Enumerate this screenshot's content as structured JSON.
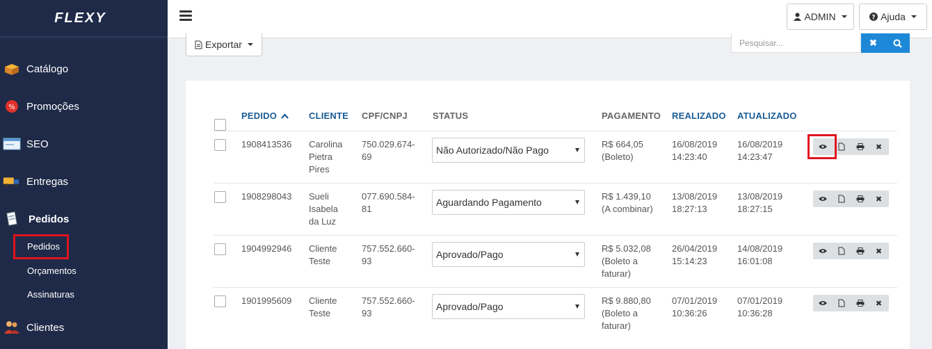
{
  "brand": {
    "logo": "FLEXY"
  },
  "sidebar": {
    "items": [
      {
        "label": "Catálogo",
        "icon": "box-icon"
      },
      {
        "label": "Promoções",
        "icon": "percent-icon"
      },
      {
        "label": "SEO",
        "icon": "window-icon"
      },
      {
        "label": "Entregas",
        "icon": "truck-icon"
      },
      {
        "label": "Pedidos",
        "icon": "document-icon"
      },
      {
        "label": "Clientes",
        "icon": "users-icon"
      }
    ],
    "subitems": [
      {
        "label": "Pedidos",
        "active": true
      },
      {
        "label": "Orçamentos"
      },
      {
        "label": "Assinaturas"
      }
    ]
  },
  "topbar": {
    "user_label": "ADMIN",
    "help_label": "Ajuda"
  },
  "toolbar": {
    "export_label": "Exportar",
    "search_placeholder": "Pesquisar..."
  },
  "table": {
    "headers": {
      "pedido": "PEDIDO",
      "cliente": "CLIENTE",
      "cpf": "CPF/CNPJ",
      "status": "STATUS",
      "pagamento": "PAGAMENTO",
      "realizado": "REALIZADO",
      "atualizado": "ATUALIZADO"
    },
    "rows": [
      {
        "pedido": "1908413536",
        "cliente": [
          "Carolina",
          "Pietra",
          "Pires"
        ],
        "cpf": [
          "750.029.674-",
          "69"
        ],
        "status": "Não Autorizado/Não Pago",
        "pagamento": [
          "R$ 664,05",
          "(Boleto)"
        ],
        "realizado": [
          "16/08/2019",
          "14:23:40"
        ],
        "atualizado": [
          "16/08/2019",
          "14:23:47"
        ]
      },
      {
        "pedido": "1908298043",
        "cliente": [
          "Sueli",
          "Isabela",
          "da Luz"
        ],
        "cpf": [
          "077.690.584-",
          "81"
        ],
        "status": "Aguardando Pagamento",
        "pagamento": [
          "R$ 1.439,10",
          "(A combinar)"
        ],
        "realizado": [
          "13/08/2019",
          "18:27:13"
        ],
        "atualizado": [
          "13/08/2019",
          "18:27:15"
        ]
      },
      {
        "pedido": "1904992946",
        "cliente": [
          "Cliente",
          "Teste"
        ],
        "cpf": [
          "757.552.660-",
          "93"
        ],
        "status": "Aprovado/Pago",
        "pagamento": [
          "R$ 5.032,08",
          "(Boleto a",
          "faturar)"
        ],
        "realizado": [
          "26/04/2019",
          "15:14:23"
        ],
        "atualizado": [
          "14/08/2019",
          "16:01:08"
        ]
      },
      {
        "pedido": "1901995609",
        "cliente": [
          "Cliente",
          "Teste"
        ],
        "cpf": [
          "757.552.660-",
          "93"
        ],
        "status": "Aprovado/Pago",
        "pagamento": [
          "R$ 9.880,80",
          "(Boleto a",
          "faturar)"
        ],
        "realizado": [
          "07/01/2019",
          "10:36:26"
        ],
        "atualizado": [
          "07/01/2019",
          "10:36:28"
        ]
      }
    ]
  }
}
